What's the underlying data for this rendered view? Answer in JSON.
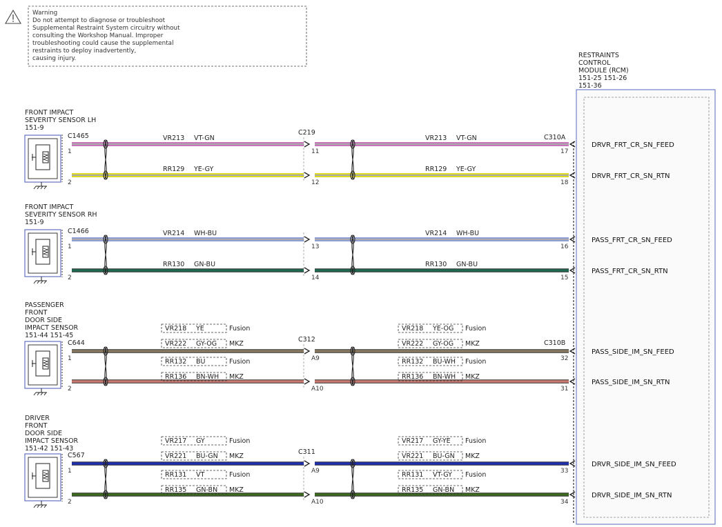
{
  "warning": {
    "lines": [
      "Warning",
      "Do not attempt to diagnose or troubleshoot",
      "Supplemental Restraint System circuitry without",
      "consulting the Workshop Manual. Improper",
      "troubleshooting could cause the supplemental",
      "restraints to deploy inadvertently,",
      "causing injury."
    ],
    "icon": "warning-triangle-icon"
  },
  "module": {
    "title_lines": [
      "RESTRAINTS",
      "CONTROL",
      "MODULE (RCM)",
      "151-25  151-26",
      "151-36"
    ],
    "connectors": {
      "a": "C310A",
      "b": "C310B"
    }
  },
  "sensors": [
    {
      "title_lines": [
        "FRONT IMPACT",
        "SEVERITY SENSOR LH",
        "151-9"
      ],
      "connector": "C1465",
      "inline": "C219",
      "wires": [
        {
          "pin_sensor": "1",
          "pin_in": "11",
          "pin_rcm": "17",
          "signal": "DRVR_FRT_CR_SN_FEED",
          "left_labels": [
            {
              "circuit": "VR213",
              "color": "VT-GN"
            }
          ],
          "right_labels": [
            {
              "circuit": "VR213",
              "color": "VT-GN"
            }
          ],
          "color": "#c060b0",
          "style": "double"
        },
        {
          "pin_sensor": "2",
          "pin_in": "12",
          "pin_rcm": "18",
          "signal": "DRVR_FRT_CR_SN_RTN",
          "left_labels": [
            {
              "circuit": "RR129",
              "color": "YE-GY"
            }
          ],
          "right_labels": [
            {
              "circuit": "RR129",
              "color": "YE-GY"
            }
          ],
          "color": "#d6d600",
          "style": "double"
        }
      ]
    },
    {
      "title_lines": [
        "FRONT IMPACT",
        "SEVERITY SENSOR RH",
        "151-9"
      ],
      "connector": "C1466",
      "inline": "",
      "wires": [
        {
          "pin_sensor": "1",
          "pin_in": "13",
          "pin_rcm": "16",
          "signal": "PASS_FRT_CR_SN_FEED",
          "left_labels": [
            {
              "circuit": "VR214",
              "color": "WH-BU"
            }
          ],
          "right_labels": [
            {
              "circuit": "VR214",
              "color": "WH-BU"
            }
          ],
          "color": "#8090d0",
          "style": "double"
        },
        {
          "pin_sensor": "2",
          "pin_in": "14",
          "pin_rcm": "15",
          "signal": "PASS_FRT_CR_SN_RTN",
          "left_labels": [
            {
              "circuit": "RR130",
              "color": "GN-BU"
            }
          ],
          "right_labels": [
            {
              "circuit": "RR130",
              "color": "GN-BU"
            }
          ],
          "color": "#1f6a50",
          "style": "solid"
        }
      ]
    },
    {
      "title_lines": [
        "PASSENGER",
        "FRONT",
        "DOOR SIDE",
        "IMPACT SENSOR",
        "151-44  151-45"
      ],
      "connector": "C644",
      "inline": "C312",
      "wires": [
        {
          "pin_sensor": "1",
          "pin_in": "A9",
          "pin_rcm": "32",
          "signal": "PASS_SIDE_IM_SN_FEED",
          "left_labels": [
            {
              "circuit": "VR218",
              "color": "YE",
              "variant": "Fusion"
            },
            {
              "circuit": "VR222",
              "color": "GY-OG",
              "variant": "MKZ"
            }
          ],
          "right_labels": [
            {
              "circuit": "VR218",
              "color": "YE-OG",
              "variant": "Fusion"
            },
            {
              "circuit": "VR222",
              "color": "GY-OG",
              "variant": "MKZ"
            }
          ],
          "color": "#8a7a62",
          "style": "solid"
        },
        {
          "pin_sensor": "2",
          "pin_in": "A10",
          "pin_rcm": "31",
          "signal": "PASS_SIDE_IM_SN_RTN",
          "left_labels": [
            {
              "circuit": "RR132",
              "color": "BU",
              "variant": "Fusion"
            },
            {
              "circuit": "RR136",
              "color": "BN-WH",
              "variant": "MKZ"
            }
          ],
          "right_labels": [
            {
              "circuit": "RR132",
              "color": "BU-WH",
              "variant": "Fusion"
            },
            {
              "circuit": "RR136",
              "color": "BN-WH",
              "variant": "MKZ"
            }
          ],
          "color": "#c87a72",
          "style": "solid"
        }
      ]
    },
    {
      "title_lines": [
        "DRIVER",
        "FRONT",
        "DOOR SIDE",
        "IMPACT SENSOR",
        "151-42  151-43"
      ],
      "connector": "C567",
      "inline": "C311",
      "wires": [
        {
          "pin_sensor": "1",
          "pin_in": "A9",
          "pin_rcm": "33",
          "signal": "DRVR_SIDE_IM_SN_FEED",
          "left_labels": [
            {
              "circuit": "VR217",
              "color": "GY",
              "variant": "Fusion"
            },
            {
              "circuit": "VR221",
              "color": "BU-GN",
              "variant": "MKZ"
            }
          ],
          "right_labels": [
            {
              "circuit": "VR217",
              "color": "GY-YE",
              "variant": "Fusion"
            },
            {
              "circuit": "VR221",
              "color": "BU-GN",
              "variant": "MKZ"
            }
          ],
          "color": "#1f2fb0",
          "style": "solid"
        },
        {
          "pin_sensor": "2",
          "pin_in": "A10",
          "pin_rcm": "34",
          "signal": "DRVR_SIDE_IM_SN_RTN",
          "left_labels": [
            {
              "circuit": "RR131",
              "color": "VT",
              "variant": "Fusion"
            },
            {
              "circuit": "RR135",
              "color": "GN-BN",
              "variant": "MKZ"
            }
          ],
          "right_labels": [
            {
              "circuit": "RR131",
              "color": "VT-GY",
              "variant": "Fusion"
            },
            {
              "circuit": "RR135",
              "color": "GN-BN",
              "variant": "MKZ"
            }
          ],
          "color": "#3d6b1f",
          "style": "solid"
        }
      ]
    }
  ]
}
